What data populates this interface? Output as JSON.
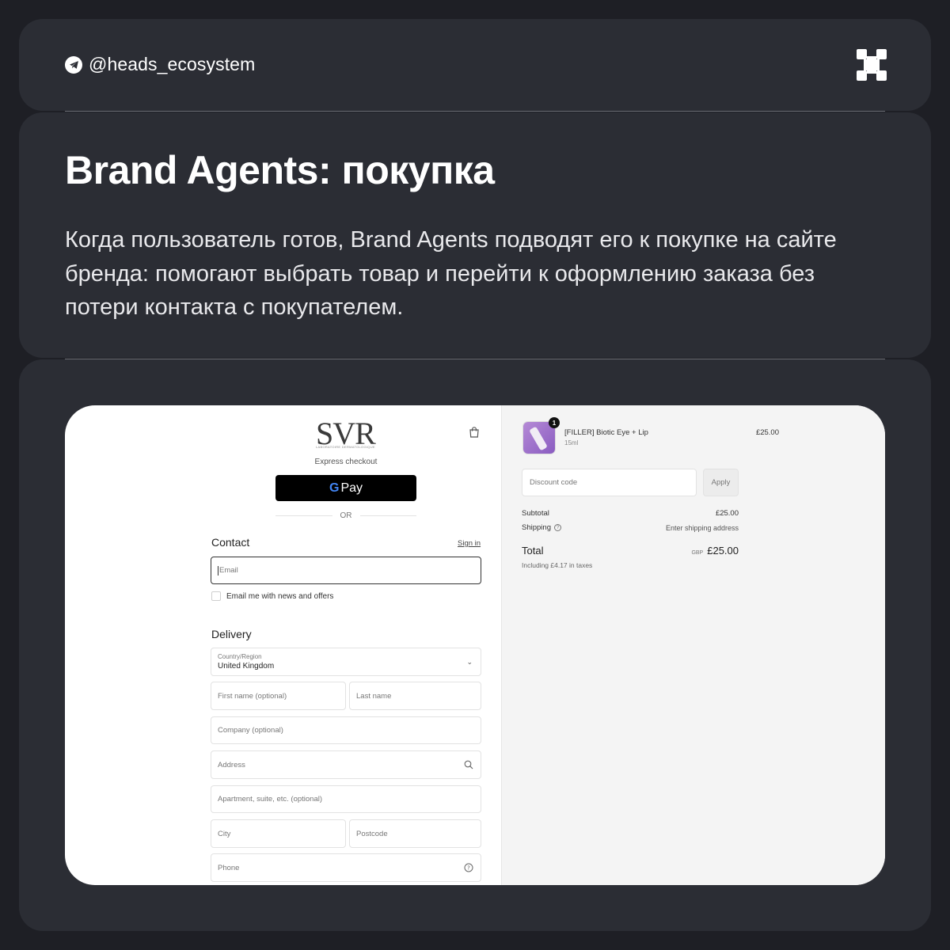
{
  "header": {
    "handle": "@heads_ecosystem"
  },
  "hero": {
    "title": "Brand Agents: покупка",
    "description": "Когда пользователь готов, Brand Agents подводят его к покупке на сайте бренда: помогают выбрать товар и перейти к оформлению заказа без потери контакта с покупателем."
  },
  "checkout": {
    "brand_logo": "SVR",
    "brand_tagline": "LABORATOIRE DERMATOLOGIQUE",
    "express_label": "Express checkout",
    "gpay_g": "G",
    "gpay_label": "Pay",
    "or_label": "OR",
    "contact": {
      "title": "Contact",
      "sign_in": "Sign in",
      "email_placeholder": "Email",
      "newsletter_label": "Email me with news and offers"
    },
    "delivery": {
      "title": "Delivery",
      "country_label": "Country/Region",
      "country_value": "United Kingdom",
      "first_name": "First name (optional)",
      "last_name": "Last name",
      "company": "Company (optional)",
      "address": "Address",
      "apartment": "Apartment, suite, etc. (optional)",
      "city": "City",
      "postcode": "Postcode",
      "phone": "Phone"
    }
  },
  "summary": {
    "item": {
      "quantity": "1",
      "name": "[FILLER] Biotic Eye + Lip",
      "variant": "15ml",
      "price": "£25.00"
    },
    "discount_placeholder": "Discount code",
    "apply_label": "Apply",
    "subtotal_label": "Subtotal",
    "subtotal_value": "£25.00",
    "shipping_label": "Shipping",
    "shipping_value": "Enter shipping address",
    "total_label": "Total",
    "total_currency": "GBP",
    "total_value": "£25.00",
    "tax_note": "Including £4.17 in taxes"
  },
  "icons": {
    "telegram": "telegram-icon",
    "brand_logo": "x-logo-icon",
    "bag": "shopping-bag-icon",
    "search": "search-icon",
    "help": "help-circle-icon",
    "chevron": "chevron-down-icon"
  },
  "colors": {
    "page_bg": "#1e1f25",
    "card_bg": "#2b2d34",
    "gpay_bg": "#000000",
    "summary_bg": "#f4f4f4"
  }
}
